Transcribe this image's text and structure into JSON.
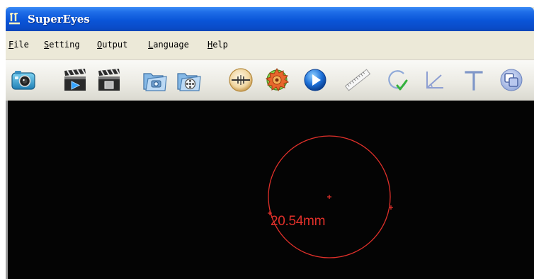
{
  "window": {
    "title": "SuperEyes"
  },
  "menu": [
    {
      "accel": "F",
      "rest": "ile"
    },
    {
      "accel": "S",
      "rest": "etting"
    },
    {
      "accel": "O",
      "rest": "utput"
    },
    {
      "accel": "L",
      "rest": "anguage"
    },
    {
      "accel": "H",
      "rest": "elp"
    }
  ],
  "toolbar": {
    "icons": [
      "camera-snapshot-icon",
      "record-video-icon",
      "stop-video-icon",
      "open-photo-folder-icon",
      "open-video-folder-icon",
      "crosshair-icon",
      "settings-gear-icon",
      "play-icon",
      "ruler-line-icon",
      "circle-measure-icon",
      "angle-measure-icon",
      "text-tool-icon",
      "layers-icon"
    ]
  },
  "measurement": {
    "diameter_text": "20.54mm",
    "color": "#e0302a"
  },
  "colors": {
    "title_bar": "#0a55d8",
    "menu_bg": "#ece9d8",
    "viewport_bg": "#040404",
    "measure": "#e0302a"
  }
}
